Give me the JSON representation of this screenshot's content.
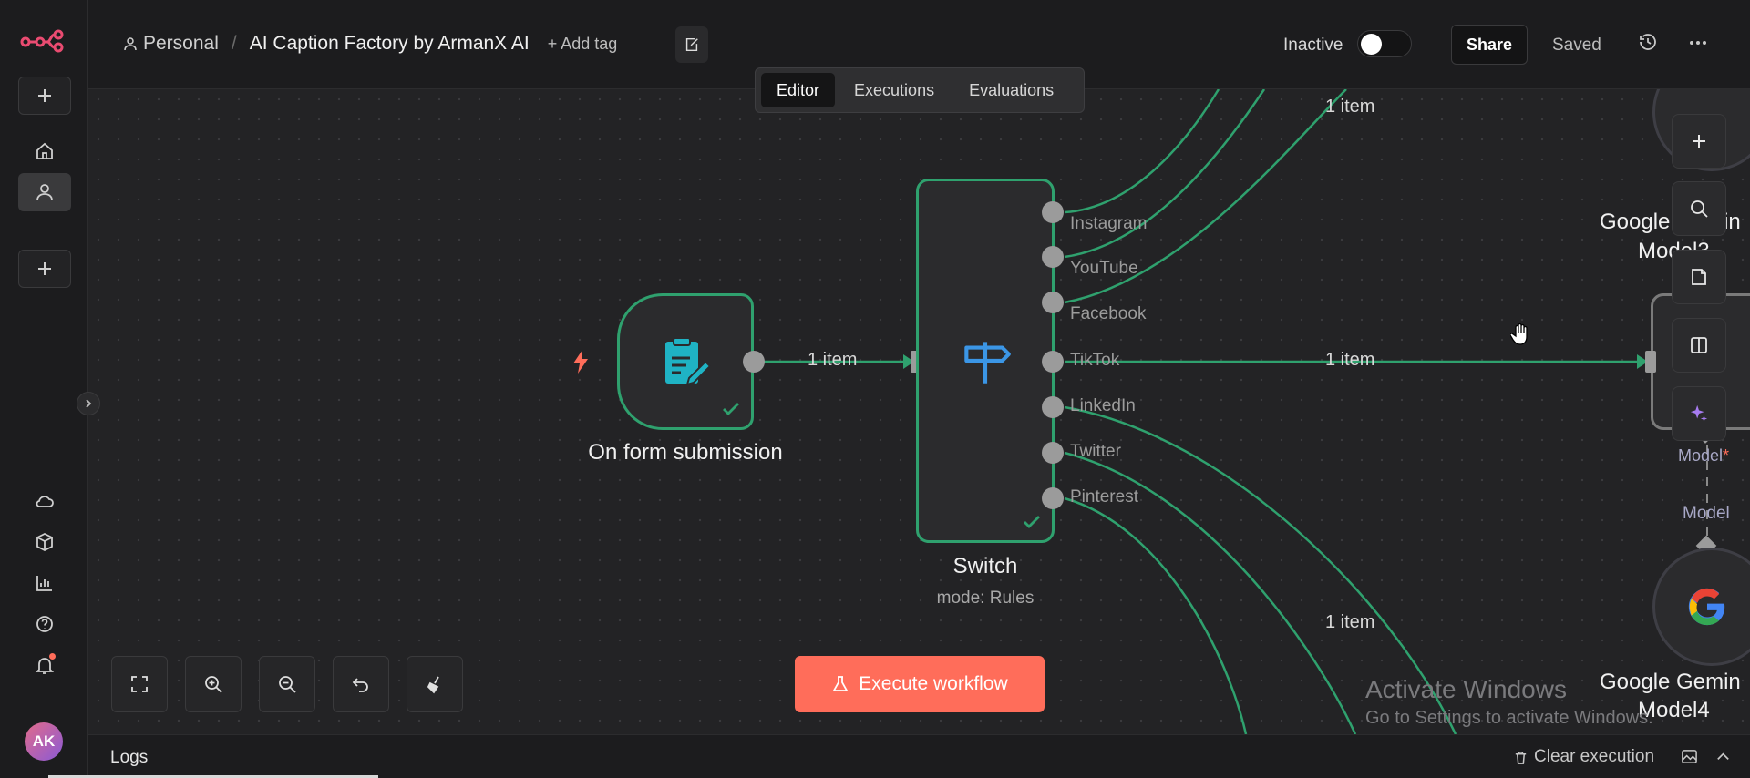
{
  "app": {
    "logo": "n8n-logo"
  },
  "sidebar": {
    "user_initials": "AK"
  },
  "header": {
    "project": "Personal",
    "separator": "/",
    "workflow_name": "AI Caption Factory by ArmanX AI",
    "add_tag": "+ Add tag",
    "status_label": "Inactive",
    "share_label": "Share",
    "saved_label": "Saved"
  },
  "tabs": [
    {
      "label": "Editor",
      "active": true
    },
    {
      "label": "Executions",
      "active": false
    },
    {
      "label": "Evaluations",
      "active": false
    }
  ],
  "nodes": {
    "form": {
      "label": "On form submission"
    },
    "switch": {
      "label": "Switch",
      "subtitle": "mode: Rules",
      "outputs": [
        "Instagram",
        "YouTube",
        "Facebook",
        "TikTok",
        "LinkedIn",
        "Twitter",
        "Pinterest"
      ]
    },
    "gemini3": {
      "label_line1": "Google Gemin",
      "label_line2": "Model3"
    },
    "gemini4": {
      "label_line1": "Google Gemin",
      "label_line2": "Model4"
    },
    "model_label_required": "Model",
    "model_required_mark": "*",
    "model_label": "Model"
  },
  "edge_labels": {
    "form_to_switch": "1 item",
    "top": "1 item",
    "tiktok": "1 item",
    "bottom": "1 item"
  },
  "execute_button": "Execute workflow",
  "watermark": {
    "line1": "Activate Windows",
    "line2": "Go to Settings to activate Windows."
  },
  "logs": {
    "title": "Logs",
    "clear": "Clear execution"
  },
  "colors": {
    "accent": "#ff6d5a",
    "success": "#2fa16e",
    "switch_icon": "#3b96e6",
    "form_icon": "#1fb3c4"
  }
}
